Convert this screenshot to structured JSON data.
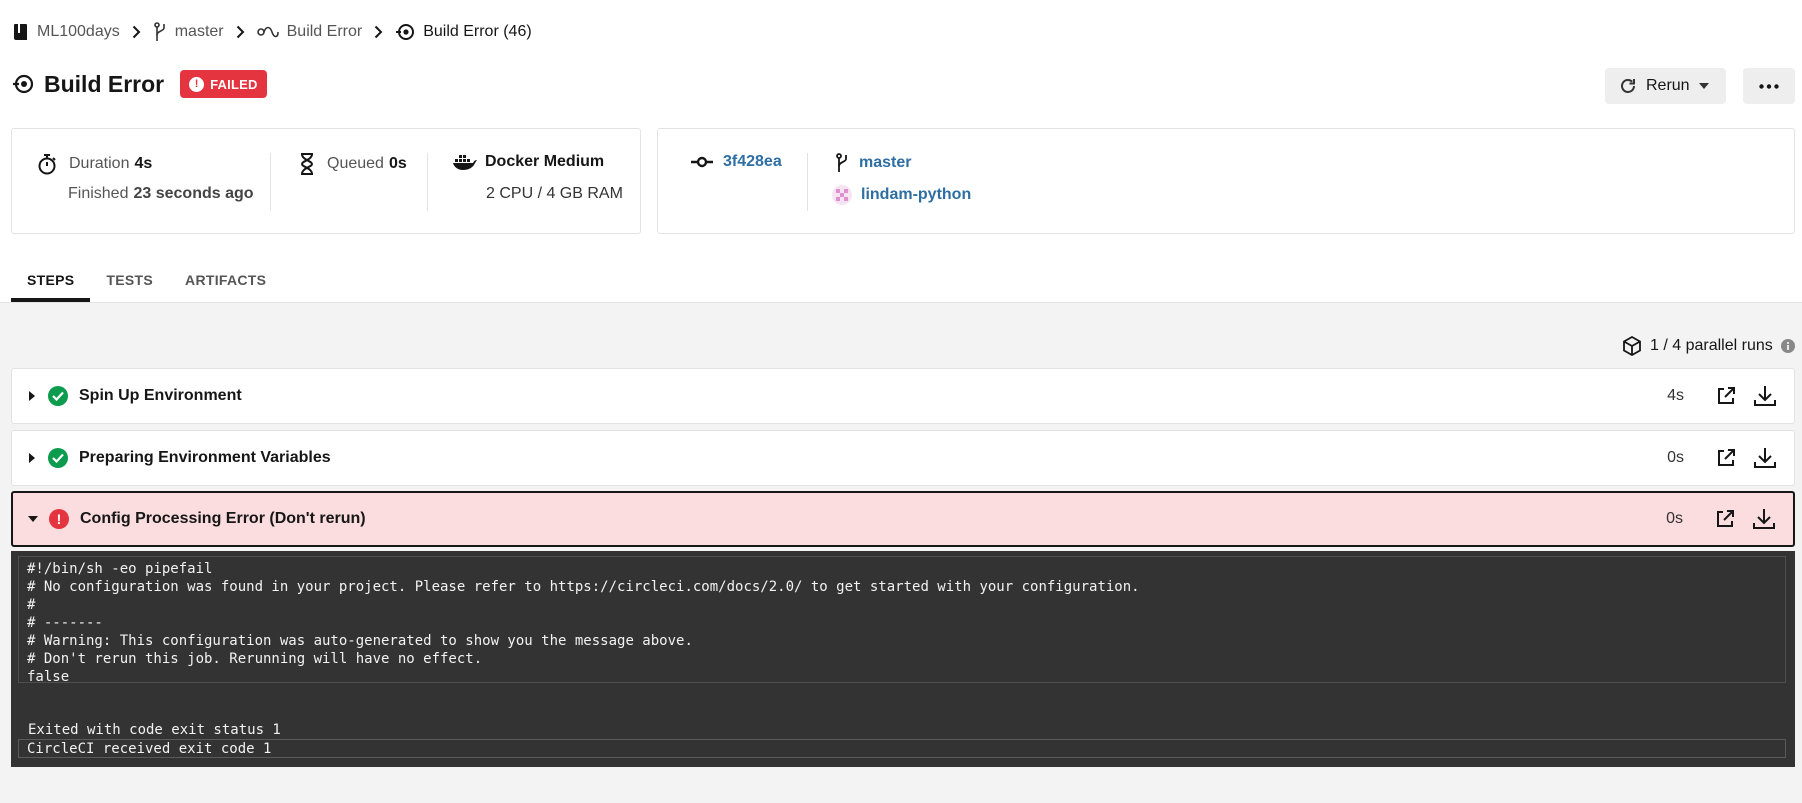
{
  "breadcrumb": {
    "project": "ML100days",
    "branch": "master",
    "workflow": "Build Error",
    "job": "Build Error (46)"
  },
  "header": {
    "title": "Build Error",
    "status_badge": "FAILED",
    "rerun_label": "Rerun"
  },
  "summary": {
    "duration_label": "Duration",
    "duration_value": "4s",
    "finished_label": "Finished",
    "finished_value": "23 seconds ago",
    "queued_label": "Queued",
    "queued_value": "0s",
    "resource_class": "Docker Medium",
    "resource_spec": "2 CPU / 4 GB RAM",
    "commit": "3f428ea",
    "branch": "master",
    "author": "lindam-python"
  },
  "tabs": [
    {
      "label": "STEPS",
      "active": true
    },
    {
      "label": "TESTS",
      "active": false
    },
    {
      "label": "ARTIFACTS",
      "active": false
    }
  ],
  "parallel_runs": "1 / 4 parallel runs",
  "steps": [
    {
      "name": "Spin Up Environment",
      "duration": "4s",
      "status": "success"
    },
    {
      "name": "Preparing Environment Variables",
      "duration": "0s",
      "status": "success"
    },
    {
      "name": "Config Processing Error (Don't rerun)",
      "duration": "0s",
      "status": "failed"
    }
  ],
  "terminal": {
    "lines": [
      "#!/bin/sh -eo pipefail",
      "# No configuration was found in your project. Please refer to https://circleci.com/docs/2.0/ to get started with your configuration.",
      "#",
      "# -------",
      "# Warning: This configuration was auto-generated to show you the message above.",
      "# Don't rerun this job. Rerunning will have no effect.",
      "false"
    ],
    "exit_line": "Exited with code exit status 1",
    "received_line": "CircleCI received exit code 1"
  },
  "colors": {
    "failed": "#e4343f",
    "success": "#0d9b4e",
    "link": "#2f6ea3",
    "error_row_bg": "#fbdcdf",
    "terminal_bg": "#333333"
  }
}
